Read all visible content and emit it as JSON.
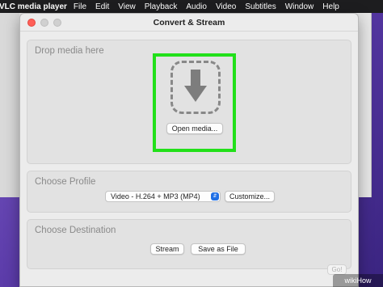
{
  "menubar": {
    "app_name": "VLC media player",
    "items": [
      "File",
      "Edit",
      "View",
      "Playback",
      "Audio",
      "Video",
      "Subtitles",
      "Window",
      "Help"
    ]
  },
  "dialog": {
    "title": "Convert & Stream",
    "drop_section": {
      "title": "Drop media here",
      "open_button": "Open media..."
    },
    "profile_section": {
      "title": "Choose Profile",
      "selected_profile": "Video - H.264 + MP3 (MP4)",
      "customize_button": "Customize..."
    },
    "destination_section": {
      "title": "Choose Destination",
      "stream_button": "Stream",
      "save_button": "Save as File"
    },
    "go_button": "Go!"
  },
  "watermark": "wikiHow",
  "colors": {
    "highlight": "#22e01a",
    "close": "#ff5f57",
    "select_arrow": "#1f6fe5"
  }
}
